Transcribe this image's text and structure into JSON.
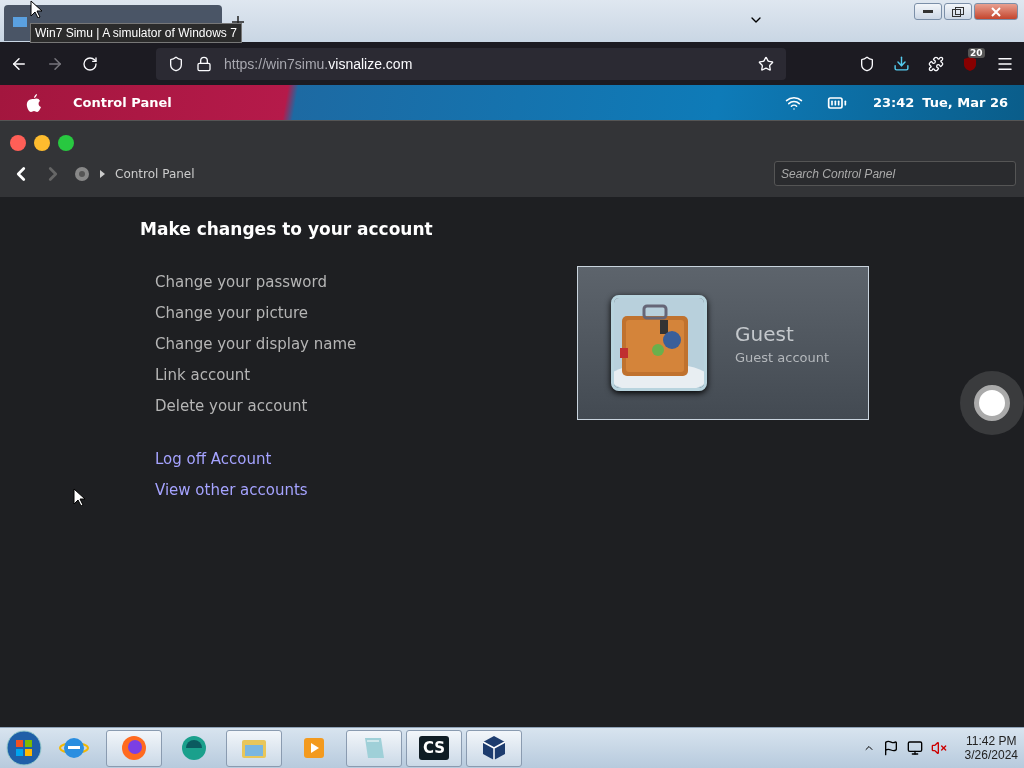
{
  "browser": {
    "tooltip": "Win7 Simu | A simulator of Windows 7",
    "url": {
      "host": "https://win7simu.",
      "domain": "visnalize.com"
    },
    "badge": "20"
  },
  "menubar": {
    "app": "Control Panel",
    "time": "23:42",
    "date": "Tue, Mar 26"
  },
  "window": {
    "breadcrumb": "Control Panel",
    "search": {
      "placeholder": "Search Control Panel"
    },
    "back_disabled": false,
    "forward_disabled": true
  },
  "heading": "Make changes to your account",
  "tasks": [
    "Change your password",
    "Change your picture",
    "Change your display name",
    "Link account",
    "Delete your account"
  ],
  "links": [
    "Log off Account",
    "View other accounts"
  ],
  "account": {
    "name": "Guest",
    "type": "Guest account"
  },
  "taskbar": {
    "apps": [
      {
        "kind": "ie",
        "open": false
      },
      {
        "kind": "firefox",
        "open": true
      },
      {
        "kind": "globe",
        "open": false
      },
      {
        "kind": "explorer",
        "open": true
      },
      {
        "kind": "media",
        "open": false
      },
      {
        "kind": "notepad",
        "open": true
      },
      {
        "kind": "cs",
        "open": true,
        "label": "CS"
      },
      {
        "kind": "box",
        "open": true
      }
    ],
    "time": "11:42 PM",
    "date": "3/26/2024"
  }
}
